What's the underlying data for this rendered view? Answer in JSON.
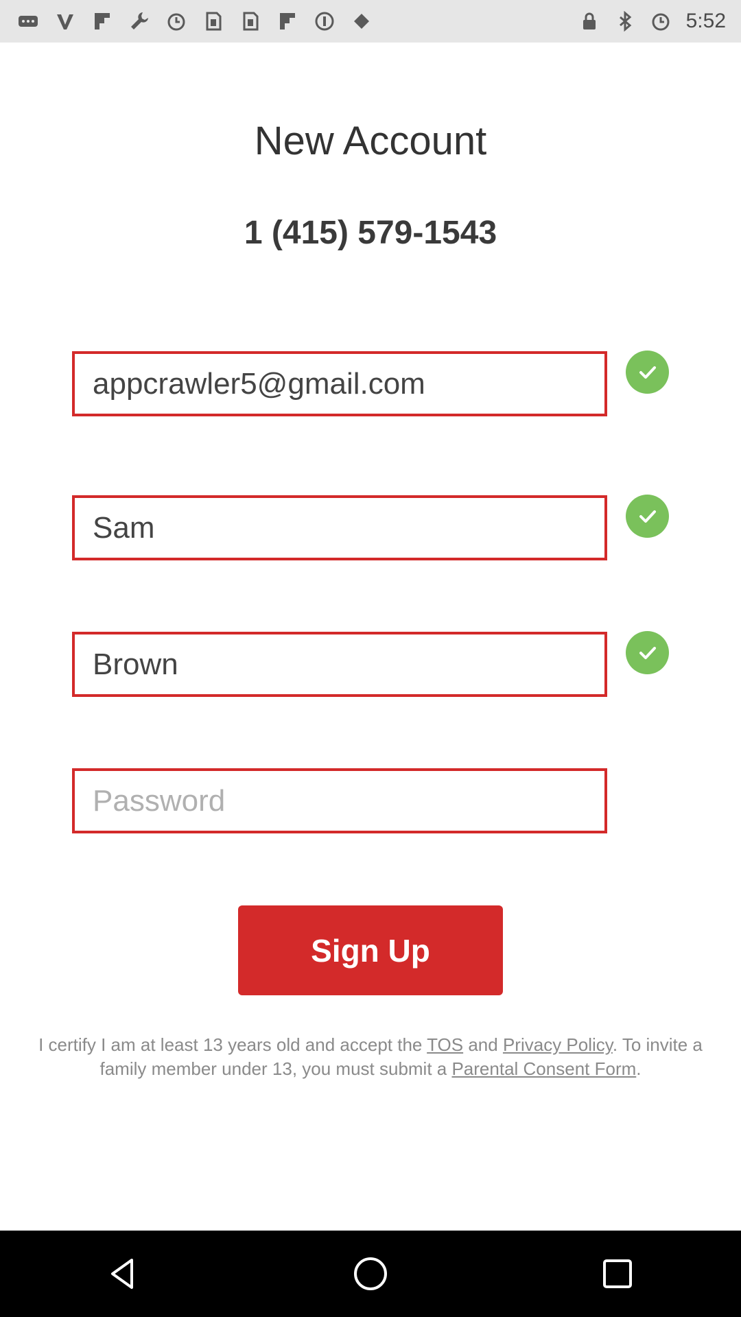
{
  "status_bar": {
    "time": "5:52",
    "left_icons": [
      "more-icon",
      "v-icon",
      "flipboard-icon",
      "wrench-icon",
      "alarm-icon",
      "sim-icon",
      "sim-icon",
      "flipboard-icon",
      "info-icon",
      "fake-gps-icon"
    ],
    "right_icons": [
      "lock-icon",
      "bluetooth-icon",
      "alarm-icon"
    ]
  },
  "header": {
    "title": "New Account",
    "phone": "1 (415) 579-1543"
  },
  "form": {
    "email_value": "appcrawler5@gmail.com",
    "first_name_value": "Sam",
    "last_name_value": "Brown",
    "password_value": "",
    "password_placeholder": "Password"
  },
  "actions": {
    "signup_label": "Sign Up"
  },
  "legal": {
    "text_1": "I certify I am at least 13 years old and accept the ",
    "tos_link": "TOS",
    "text_2": " and ",
    "privacy_link": "Privacy Policy",
    "text_3": ". To invite a family member under 13, you must submit a ",
    "consent_link": "Parental Consent Form",
    "text_4": "."
  },
  "colors": {
    "accent": "#d32a2a",
    "success": "#7ac15b"
  }
}
